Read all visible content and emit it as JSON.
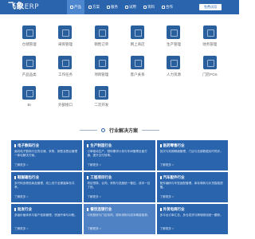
{
  "header": {
    "logo_main": "飞象",
    "logo_sub": "ERP",
    "nav": [
      {
        "label": "产品",
        "active": true
      },
      {
        "label": "方案",
        "active": false
      },
      {
        "label": "服务",
        "active": false
      },
      {
        "label": "试用",
        "active": false
      },
      {
        "label": "资料",
        "active": false
      },
      {
        "label": "合作",
        "active": false
      }
    ],
    "login_label": "免费试用"
  },
  "modules": [
    {
      "label": "仓储管理",
      "icon": "warehouse-icon"
    },
    {
      "label": "采购管理",
      "icon": "cart-icon"
    },
    {
      "label": "销售订单",
      "icon": "order-icon"
    },
    {
      "label": "网上商店",
      "icon": "shop-icon"
    },
    {
      "label": "生产管理",
      "icon": "factory-icon"
    },
    {
      "label": "财务管理",
      "icon": "finance-icon"
    },
    {
      "label": "产品品类",
      "icon": "category-icon"
    },
    {
      "label": "工作任务",
      "icon": "task-icon"
    },
    {
      "label": "项目管理",
      "icon": "project-icon"
    },
    {
      "label": "客户关系",
      "icon": "customer-icon"
    },
    {
      "label": "人力资源",
      "icon": "people-icon"
    },
    {
      "label": "门店POS",
      "icon": "pos-icon"
    },
    {
      "label": "BI",
      "icon": "chart-icon"
    },
    {
      "label": "外部接口",
      "icon": "api-icon"
    },
    {
      "label": "二次开发",
      "icon": "code-icon"
    }
  ],
  "section": {
    "title": "行业解决方案"
  },
  "industries": [
    {
      "title": "电子数码行业",
      "desc": "面向电子数码行业的仓储、采购、销售及售后管理一体化解决方案。",
      "more": "了解更多 >"
    },
    {
      "title": "生产制造行业",
      "desc": "订单驱动生产，物料需求计划与车间管理全面打通，提升交付效率。",
      "more": "了解更多 >"
    },
    {
      "title": "医药零售行业",
      "desc": "批次与效期精细管理，门店与总部数据实时同步。",
      "more": "了解更多 >"
    },
    {
      "title": "鞋服箱包行业",
      "desc": "多尺码多颜色商品管理，线上线下全渠道库存共享。",
      "more": "了解更多 >"
    },
    {
      "title": "工程项目行业",
      "desc": "项目预算、合同、采购与进度统一管控，成本一目了然。",
      "more": "了解更多 >"
    },
    {
      "title": "汽车配件行业",
      "desc": "配件编码与车型适配管理，库存周转与补货智能提醒。",
      "more": "了解更多 >"
    },
    {
      "title": "批发行业",
      "desc": "多级价格体系与客户信用管理，快速开单与对账。",
      "more": "了解更多 >"
    },
    {
      "title": "餐饮连锁行业",
      "desc": "中央厨房与门店协同，原料采购与成本精准核算。",
      "more": "了解更多 >"
    },
    {
      "title": "外贸电商行业",
      "desc": "多平台订单汇总，多仓发货与跨境物流统一跟踪。",
      "more": "了解更多 >"
    }
  ]
}
